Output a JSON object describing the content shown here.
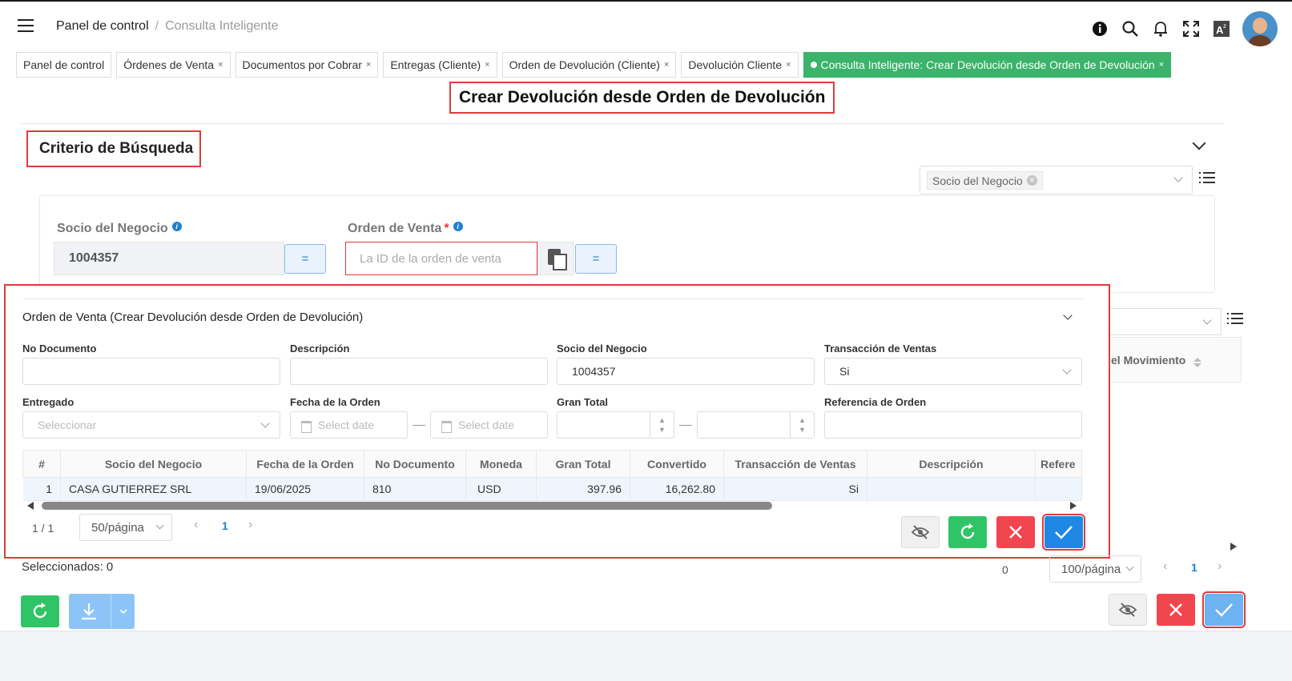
{
  "header": {
    "breadcrumb_home": "Panel de control",
    "breadcrumb_sep": "/",
    "breadcrumb_current": "Consulta Inteligente"
  },
  "tabs": [
    {
      "label": "Panel de control",
      "closable": false
    },
    {
      "label": "Órdenes de Venta",
      "closable": true
    },
    {
      "label": "Documentos por Cobrar",
      "closable": true
    },
    {
      "label": "Entregas (Cliente)",
      "closable": true
    },
    {
      "label": "Orden de Devolución (Cliente)",
      "closable": true
    },
    {
      "label": "Devolución Cliente",
      "closable": true
    },
    {
      "label": "Consulta Inteligente: Crear Devolución desde Orden de Devolución",
      "closable": true,
      "active": true
    }
  ],
  "tab_close_glyph": "×",
  "page_title": "Crear Devolución desde Orden de Devolución",
  "criteria": {
    "title": "Criterio de Búsqueda",
    "filter_chip": "Socio del Negocio",
    "socio_label": "Socio del Negocio",
    "socio_value": "1004357",
    "orden_label": "Orden de Venta",
    "orden_required": "*",
    "orden_placeholder": "La ID de la orden de venta",
    "eq_label": "="
  },
  "background_table": {
    "column_partial": "el Movimiento",
    "count": "0",
    "page_size": "100/página",
    "page": "1"
  },
  "modal": {
    "title": "Orden de Venta (Crear Devolución desde Orden de Devolución)",
    "fields": {
      "no_documento": {
        "label": "No Documento",
        "value": ""
      },
      "descripcion": {
        "label": "Descripción",
        "value": ""
      },
      "socio": {
        "label": "Socio del Negocio",
        "value": "1004357"
      },
      "transaccion": {
        "label": "Transacción de Ventas",
        "value": "Si"
      },
      "entregado": {
        "label": "Entregado",
        "placeholder": "Seleccionar"
      },
      "fecha": {
        "label": "Fecha de la Orden",
        "placeholder": "Select date"
      },
      "gran_total": {
        "label": "Gran Total"
      },
      "referencia": {
        "label": "Referencia de Orden",
        "value": ""
      }
    },
    "columns": [
      "#",
      "Socio del Negocio",
      "Fecha de la Orden",
      "No Documento",
      "Moneda",
      "Gran Total",
      "Convertido",
      "Transacción de Ventas",
      "Descripción",
      "Refere"
    ],
    "rows": [
      {
        "n": "1",
        "socio": "CASA GUTIERREZ SRL",
        "fecha": "19/06/2025",
        "doc": "810",
        "moneda": "USD",
        "gran_total": "397.96",
        "convertido": "16,262.80",
        "transaccion": "Si",
        "descripcion": "",
        "referencia": ""
      }
    ],
    "pager": {
      "range": "1 / 1",
      "page_size": "50/página",
      "page": "1"
    }
  },
  "selected_label": "Seleccionados: 0",
  "colors": {
    "accent_green": "#3bb36a",
    "danger": "#e03b3b",
    "primary": "#1f88e5"
  }
}
